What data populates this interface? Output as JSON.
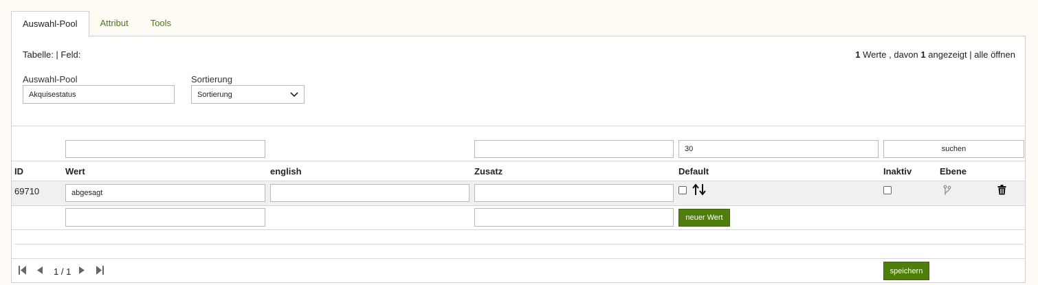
{
  "tabs": [
    {
      "label": "Auswahl-Pool"
    },
    {
      "label": "Attribut"
    },
    {
      "label": "Tools"
    }
  ],
  "info": {
    "left": "Tabelle: | Feld:",
    "total": "1",
    "werte_label": "Werte , davon",
    "shown": "1",
    "shown_label": "angezeigt | alle öffnen"
  },
  "pool_field": {
    "label": "Auswahl-Pool",
    "value": "Akquisestatus"
  },
  "sort_field": {
    "label": "Sortierung",
    "value": "Sortierung"
  },
  "filters": {
    "wert": "",
    "zusatz": "",
    "limit": "30",
    "search_button": "suchen"
  },
  "columns": {
    "id": "ID",
    "wert": "Wert",
    "english": "english",
    "zusatz": "Zusatz",
    "default": "Default",
    "inaktiv": "Inaktiv",
    "ebene": "Ebene"
  },
  "rows": [
    {
      "id": "69710",
      "wert": "abgesagt",
      "english": "",
      "zusatz": ""
    }
  ],
  "new_row": {
    "wert": "",
    "zusatz": "",
    "button": "neuer Wert"
  },
  "pagination": {
    "page": "1 / 1"
  },
  "save_button": "speichern",
  "colors": {
    "accent": "#4f7f0b",
    "tab_link": "#4d7a0f"
  }
}
